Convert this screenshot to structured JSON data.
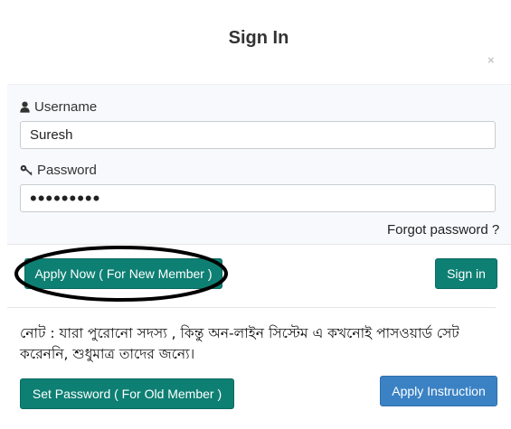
{
  "modal": {
    "title": "Sign In",
    "close_glyph": "×"
  },
  "form": {
    "username_label": "Username",
    "username_value": "Suresh",
    "password_label": "Password",
    "password_value": "•••••••••",
    "forgot_link": "Forgot password ?"
  },
  "actions": {
    "apply_now_label": "Apply Now ( For New Member )",
    "sign_in_label": "Sign in"
  },
  "note": {
    "text": "নোট : যারা পুরোনো সদস্য , কিন্তু অন-লাইন সিস্টেম এ কখনোই পাসওয়ার্ড সেট করেননি, শুধুমাত্র তাদের জন্যে।"
  },
  "footer": {
    "set_password_label": "Set Password ( For Old Member )",
    "apply_instruction_label": "Apply Instruction"
  },
  "colors": {
    "teal_button": "#0e7f73",
    "blue_button": "#3a82c4",
    "annotation_ellipse": "#000000"
  },
  "icons": {
    "username": "user-icon",
    "password": "key-icon"
  }
}
